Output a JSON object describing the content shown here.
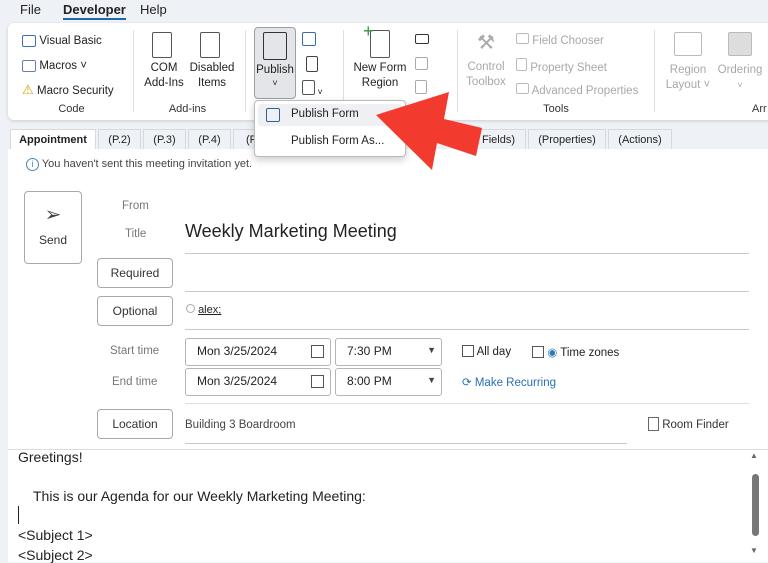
{
  "menu": {
    "file": "File",
    "developer": "Developer",
    "help": "Help"
  },
  "ribbon": {
    "code": {
      "visual_basic": "Visual Basic",
      "macros": "Macros",
      "macro_security": "Macro Security",
      "label": "Code"
    },
    "addins": {
      "com": [
        "COM",
        "Add-Ins"
      ],
      "disabled": [
        "Disabled",
        "Items"
      ],
      "label": "Add-ins"
    },
    "publish": {
      "label": "Publish"
    },
    "form_region": {
      "new": [
        "New Form",
        "Region"
      ]
    },
    "tools": {
      "control": [
        "Control",
        "Toolbox"
      ],
      "field_chooser": "Field Chooser",
      "property_sheet": "Property Sheet",
      "advanced": "Advanced Properties",
      "label": "Tools"
    },
    "arrange": {
      "region": [
        "Region",
        "Layout"
      ],
      "ordering": "Ordering",
      "label": "Arr"
    }
  },
  "dropdown": {
    "items": [
      "Publish Form",
      "Publish Form As..."
    ]
  },
  "tabs": [
    "Appointment",
    "(P.2)",
    "(P.3)",
    "(P.4)",
    "(P",
    "Fields)",
    "(Properties)",
    "(Actions)"
  ],
  "info": "You haven't sent this meeting invitation yet.",
  "form": {
    "send": "Send",
    "from": "From",
    "title_label": "Title",
    "title": "Weekly Marketing Meeting",
    "required": "Required",
    "optional": "Optional",
    "optional_value": "alex;",
    "start_label": "Start time",
    "end_label": "End time",
    "start_date": "Mon 3/25/2024",
    "start_time": "7:30 PM",
    "end_date": "Mon 3/25/2024",
    "end_time": "8:00 PM",
    "all_day": "All day",
    "time_zones": "Time zones",
    "make_recurring": "Make Recurring",
    "location": "Location",
    "location_value": "Building 3 Boardroom",
    "room_finder": "Room Finder"
  },
  "body": {
    "lines": [
      "Greetings!",
      "This is our Agenda for our Weekly Marketing Meeting:",
      "<Subject 1>",
      "<Subject 2>"
    ]
  },
  "colors": {
    "accent": "#1e66b0",
    "arrow": "#f33a2f",
    "link": "#2a6fb5"
  }
}
